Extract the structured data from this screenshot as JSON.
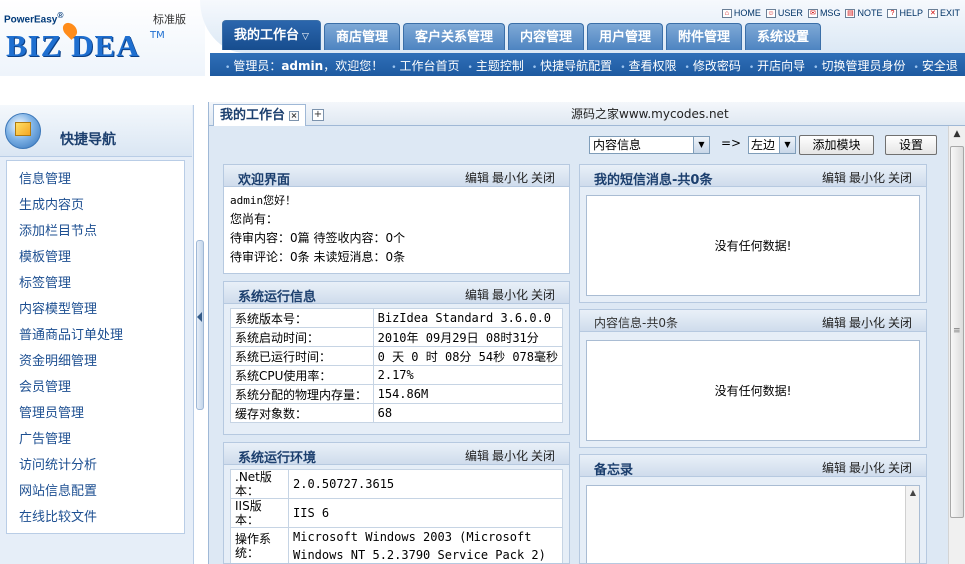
{
  "brand": {
    "powereasy": "PowerEasy",
    "reg": "®",
    "edition": "标准版",
    "logo": "BIZ DEA",
    "tm": "TM"
  },
  "quick_links": [
    {
      "label": "HOME",
      "icon": "home-icon"
    },
    {
      "label": "USER",
      "icon": "user-icon"
    },
    {
      "label": "MSG",
      "icon": "mail-icon"
    },
    {
      "label": "NOTE",
      "icon": "note-icon"
    },
    {
      "label": "HELP",
      "icon": "help-icon"
    },
    {
      "label": "EXIT",
      "icon": "exit-icon"
    }
  ],
  "main_tabs": [
    {
      "label": "我的工作台",
      "active": true
    },
    {
      "label": "商店管理"
    },
    {
      "label": "客户关系管理"
    },
    {
      "label": "内容管理"
    },
    {
      "label": "用户管理"
    },
    {
      "label": "附件管理"
    },
    {
      "label": "系统设置"
    }
  ],
  "subnav": {
    "admin_prefix": "管理员：",
    "admin_name": "admin",
    "welcome": "，欢迎您！",
    "items": [
      "工作台首页",
      "主题控制",
      "快捷导航配置",
      "查看权限",
      "修改密码",
      "开店向导",
      "切换管理员身份",
      "安全退"
    ]
  },
  "sidebar": {
    "title": "快捷导航",
    "items": [
      "信息管理",
      "生成内容页",
      "添加栏目节点",
      "模板管理",
      "标签管理",
      "内容模型管理",
      "普通商品订单处理",
      "资金明细管理",
      "会员管理",
      "管理员管理",
      "广告管理",
      "访问统计分析",
      "网站信息配置",
      "在线比较文件"
    ]
  },
  "tabbar": {
    "workspace_tab": "我的工作台",
    "close": "×",
    "add": "+",
    "site_label": "源码之家www.mycodes.net"
  },
  "toolbar": {
    "module_select": "内容信息",
    "arrow": "=>",
    "position_select": "左边",
    "add_button": "添加模块",
    "settings_button": "设置"
  },
  "panel_controls": {
    "edit": "编辑",
    "minimize": "最小化",
    "close": "关闭"
  },
  "welcome": {
    "title": "欢迎界面",
    "greeting": "admin您好！",
    "you_have": "您尚有：",
    "pending_line": "待审内容：0篇 待签收内容：0个",
    "comment_line": "待审评论：0条 未读短消息：0条"
  },
  "sysinfo": {
    "title": "系统运行信息",
    "rows": [
      {
        "k": "系统版本号：",
        "v": "BizIdea Standard 3.6.0.0"
      },
      {
        "k": "系统启动时间：",
        "v": "2010年 09月29日 08时31分"
      },
      {
        "k": "系统已运行时间：",
        "v": "0 天 0 时 08分 54秒 078毫秒"
      },
      {
        "k": "系统CPU使用率：",
        "v": "2.17%"
      },
      {
        "k": "系统分配的物理内存量：",
        "v": "154.86M"
      },
      {
        "k": "缓存对象数：",
        "v": "68"
      }
    ]
  },
  "sysenv": {
    "title": "系统运行环境",
    "rows": [
      {
        "k": ".Net版本：",
        "v": "2.0.50727.3615"
      },
      {
        "k": "IIS版本：",
        "v": "IIS 6"
      },
      {
        "k": "操作系统：",
        "v": "Microsoft Windows 2003 (Microsoft Windows NT 5.2.3790 Service Pack 2)"
      }
    ]
  },
  "sms": {
    "title": "我的短信消息-共0条",
    "empty": "没有任何数据!"
  },
  "content_info": {
    "title": "内容信息-共0条",
    "empty": "没有任何数据!"
  },
  "memo": {
    "title": "备忘录"
  }
}
